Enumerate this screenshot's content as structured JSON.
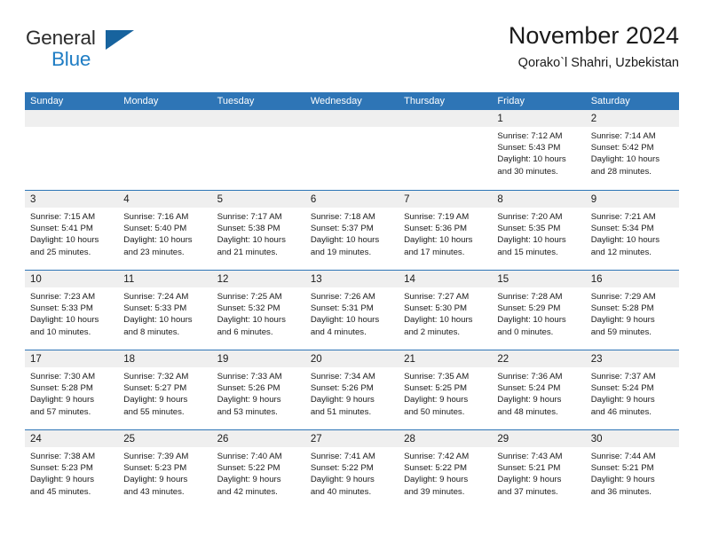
{
  "brand": {
    "name_part1": "General",
    "name_part2": "Blue",
    "triangle_color": "#17639e",
    "blue_color": "#1f7dc4"
  },
  "header": {
    "title": "November 2024",
    "subtitle": "Qorako`l Shahri, Uzbekistan"
  },
  "theme": {
    "header_blue": "#2e75b6",
    "day_band_gray": "#efefef",
    "text_color": "#1a1a1a"
  },
  "weekdays": [
    "Sunday",
    "Monday",
    "Tuesday",
    "Wednesday",
    "Thursday",
    "Friday",
    "Saturday"
  ],
  "weeks": [
    [
      {
        "day": "",
        "lines": []
      },
      {
        "day": "",
        "lines": []
      },
      {
        "day": "",
        "lines": []
      },
      {
        "day": "",
        "lines": []
      },
      {
        "day": "",
        "lines": []
      },
      {
        "day": "1",
        "lines": [
          "Sunrise: 7:12 AM",
          "Sunset: 5:43 PM",
          "Daylight: 10 hours",
          "and 30 minutes."
        ]
      },
      {
        "day": "2",
        "lines": [
          "Sunrise: 7:14 AM",
          "Sunset: 5:42 PM",
          "Daylight: 10 hours",
          "and 28 minutes."
        ]
      }
    ],
    [
      {
        "day": "3",
        "lines": [
          "Sunrise: 7:15 AM",
          "Sunset: 5:41 PM",
          "Daylight: 10 hours",
          "and 25 minutes."
        ]
      },
      {
        "day": "4",
        "lines": [
          "Sunrise: 7:16 AM",
          "Sunset: 5:40 PM",
          "Daylight: 10 hours",
          "and 23 minutes."
        ]
      },
      {
        "day": "5",
        "lines": [
          "Sunrise: 7:17 AM",
          "Sunset: 5:38 PM",
          "Daylight: 10 hours",
          "and 21 minutes."
        ]
      },
      {
        "day": "6",
        "lines": [
          "Sunrise: 7:18 AM",
          "Sunset: 5:37 PM",
          "Daylight: 10 hours",
          "and 19 minutes."
        ]
      },
      {
        "day": "7",
        "lines": [
          "Sunrise: 7:19 AM",
          "Sunset: 5:36 PM",
          "Daylight: 10 hours",
          "and 17 minutes."
        ]
      },
      {
        "day": "8",
        "lines": [
          "Sunrise: 7:20 AM",
          "Sunset: 5:35 PM",
          "Daylight: 10 hours",
          "and 15 minutes."
        ]
      },
      {
        "day": "9",
        "lines": [
          "Sunrise: 7:21 AM",
          "Sunset: 5:34 PM",
          "Daylight: 10 hours",
          "and 12 minutes."
        ]
      }
    ],
    [
      {
        "day": "10",
        "lines": [
          "Sunrise: 7:23 AM",
          "Sunset: 5:33 PM",
          "Daylight: 10 hours",
          "and 10 minutes."
        ]
      },
      {
        "day": "11",
        "lines": [
          "Sunrise: 7:24 AM",
          "Sunset: 5:33 PM",
          "Daylight: 10 hours",
          "and 8 minutes."
        ]
      },
      {
        "day": "12",
        "lines": [
          "Sunrise: 7:25 AM",
          "Sunset: 5:32 PM",
          "Daylight: 10 hours",
          "and 6 minutes."
        ]
      },
      {
        "day": "13",
        "lines": [
          "Sunrise: 7:26 AM",
          "Sunset: 5:31 PM",
          "Daylight: 10 hours",
          "and 4 minutes."
        ]
      },
      {
        "day": "14",
        "lines": [
          "Sunrise: 7:27 AM",
          "Sunset: 5:30 PM",
          "Daylight: 10 hours",
          "and 2 minutes."
        ]
      },
      {
        "day": "15",
        "lines": [
          "Sunrise: 7:28 AM",
          "Sunset: 5:29 PM",
          "Daylight: 10 hours",
          "and 0 minutes."
        ]
      },
      {
        "day": "16",
        "lines": [
          "Sunrise: 7:29 AM",
          "Sunset: 5:28 PM",
          "Daylight: 9 hours",
          "and 59 minutes."
        ]
      }
    ],
    [
      {
        "day": "17",
        "lines": [
          "Sunrise: 7:30 AM",
          "Sunset: 5:28 PM",
          "Daylight: 9 hours",
          "and 57 minutes."
        ]
      },
      {
        "day": "18",
        "lines": [
          "Sunrise: 7:32 AM",
          "Sunset: 5:27 PM",
          "Daylight: 9 hours",
          "and 55 minutes."
        ]
      },
      {
        "day": "19",
        "lines": [
          "Sunrise: 7:33 AM",
          "Sunset: 5:26 PM",
          "Daylight: 9 hours",
          "and 53 minutes."
        ]
      },
      {
        "day": "20",
        "lines": [
          "Sunrise: 7:34 AM",
          "Sunset: 5:26 PM",
          "Daylight: 9 hours",
          "and 51 minutes."
        ]
      },
      {
        "day": "21",
        "lines": [
          "Sunrise: 7:35 AM",
          "Sunset: 5:25 PM",
          "Daylight: 9 hours",
          "and 50 minutes."
        ]
      },
      {
        "day": "22",
        "lines": [
          "Sunrise: 7:36 AM",
          "Sunset: 5:24 PM",
          "Daylight: 9 hours",
          "and 48 minutes."
        ]
      },
      {
        "day": "23",
        "lines": [
          "Sunrise: 7:37 AM",
          "Sunset: 5:24 PM",
          "Daylight: 9 hours",
          "and 46 minutes."
        ]
      }
    ],
    [
      {
        "day": "24",
        "lines": [
          "Sunrise: 7:38 AM",
          "Sunset: 5:23 PM",
          "Daylight: 9 hours",
          "and 45 minutes."
        ]
      },
      {
        "day": "25",
        "lines": [
          "Sunrise: 7:39 AM",
          "Sunset: 5:23 PM",
          "Daylight: 9 hours",
          "and 43 minutes."
        ]
      },
      {
        "day": "26",
        "lines": [
          "Sunrise: 7:40 AM",
          "Sunset: 5:22 PM",
          "Daylight: 9 hours",
          "and 42 minutes."
        ]
      },
      {
        "day": "27",
        "lines": [
          "Sunrise: 7:41 AM",
          "Sunset: 5:22 PM",
          "Daylight: 9 hours",
          "and 40 minutes."
        ]
      },
      {
        "day": "28",
        "lines": [
          "Sunrise: 7:42 AM",
          "Sunset: 5:22 PM",
          "Daylight: 9 hours",
          "and 39 minutes."
        ]
      },
      {
        "day": "29",
        "lines": [
          "Sunrise: 7:43 AM",
          "Sunset: 5:21 PM",
          "Daylight: 9 hours",
          "and 37 minutes."
        ]
      },
      {
        "day": "30",
        "lines": [
          "Sunrise: 7:44 AM",
          "Sunset: 5:21 PM",
          "Daylight: 9 hours",
          "and 36 minutes."
        ]
      }
    ]
  ]
}
